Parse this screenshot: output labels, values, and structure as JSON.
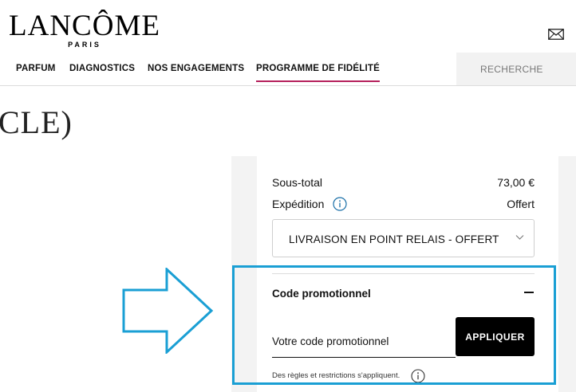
{
  "brand": {
    "name": "LANCÔME",
    "subname": "PARIS"
  },
  "header": {
    "mail_icon": "envelope-icon"
  },
  "nav": {
    "items": [
      {
        "label": "PARFUM"
      },
      {
        "label": "DIAGNOSTICS"
      },
      {
        "label": "NOS ENGAGEMENTS"
      },
      {
        "label": "PROGRAMME DE FIDÉLITÉ",
        "active": true
      }
    ],
    "search_label": "RECHERCHE",
    "active_color": "#b51f5b"
  },
  "page": {
    "title_fragment": "CLE)"
  },
  "summary": {
    "subtotal_label": "Sous-total",
    "subtotal_value": "73,00 €",
    "shipping_label": "Expédition",
    "shipping_value": "Offert",
    "shipping_option": "LIVRAISON EN POINT RELAIS - OFFERT"
  },
  "promo": {
    "title": "Code promotionnel",
    "placeholder": "Votre code promotionnel",
    "apply_label": "APPLIQUER",
    "rules_text": "Des règles et restrictions s'appliquent."
  },
  "annotation": {
    "highlight_color": "#1a9fd4"
  }
}
